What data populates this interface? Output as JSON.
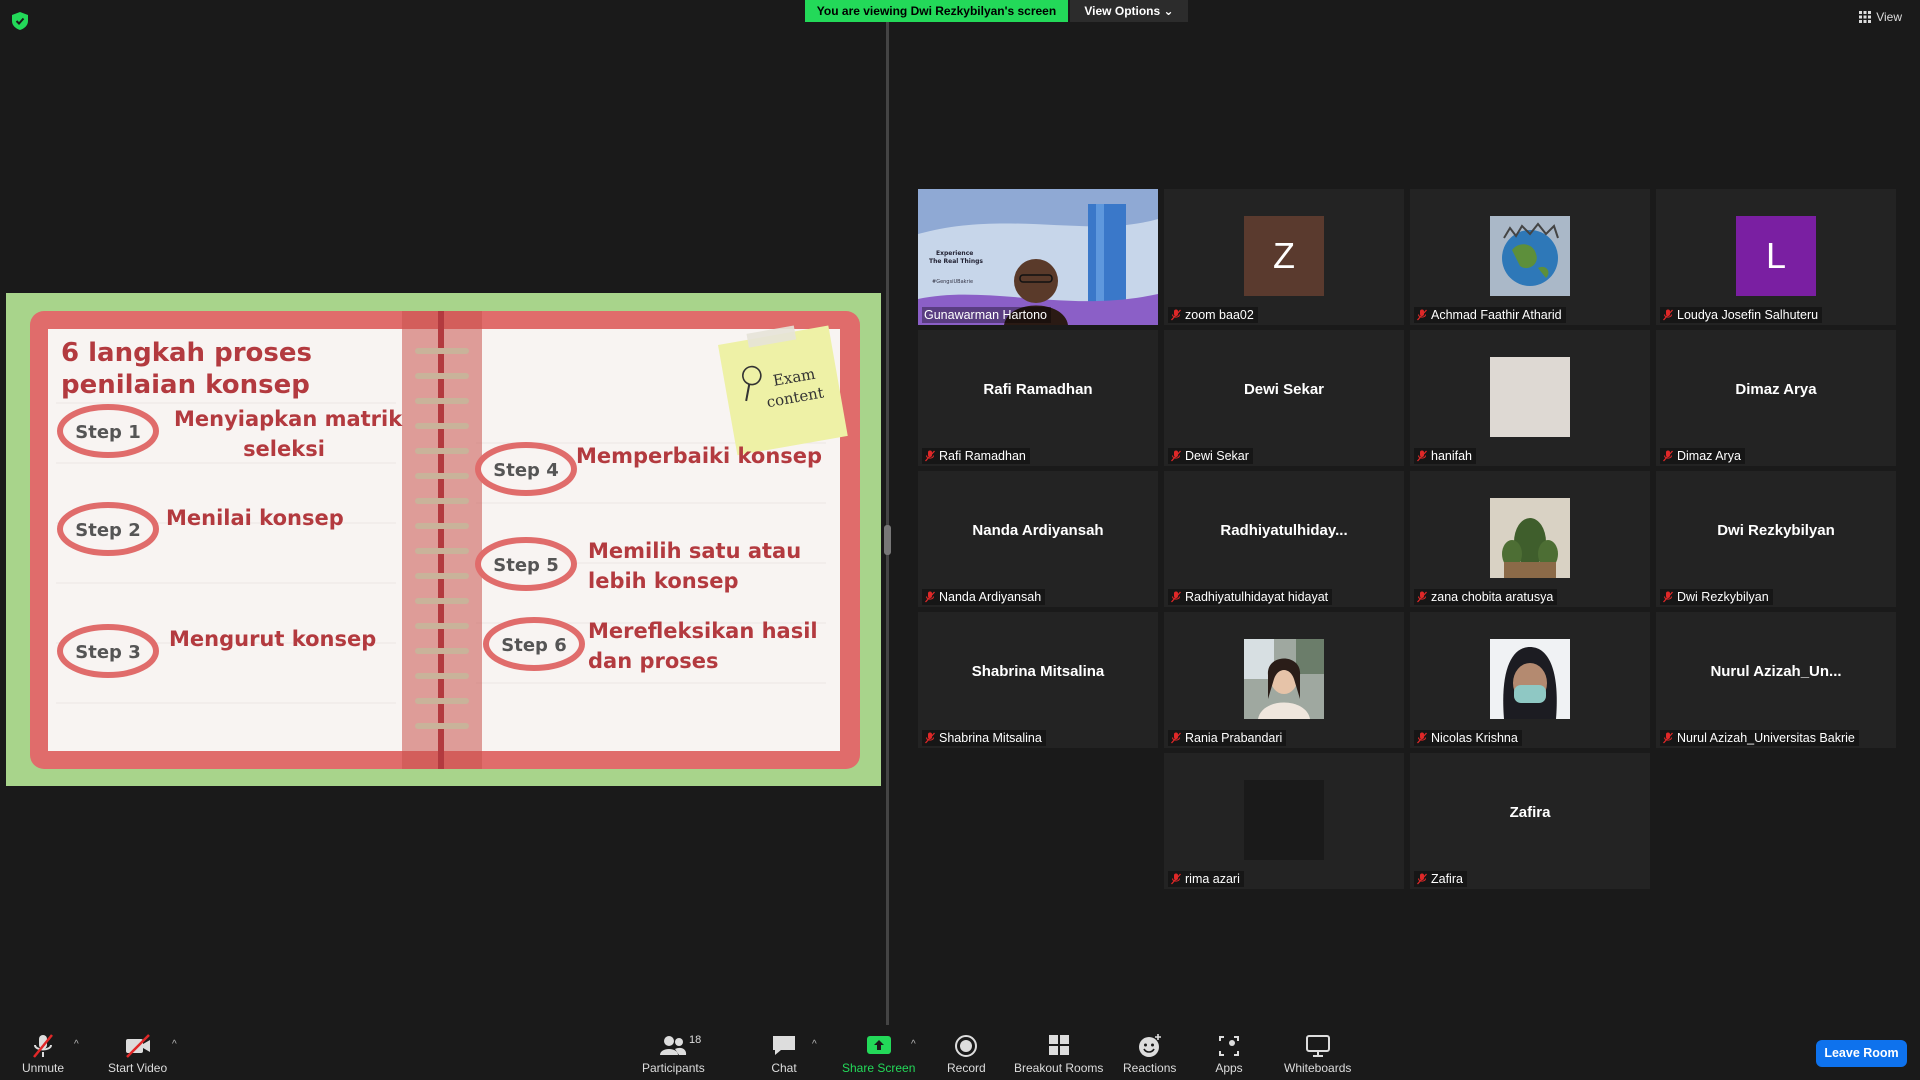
{
  "window": {
    "banner_text": "You are viewing Dwi Rezkybilyan's screen",
    "view_options_label": "View Options",
    "view_label": "View"
  },
  "slide": {
    "title_line1": "6 langkah proses",
    "title_line2": "penilaian konsep",
    "note_line1": "Exam",
    "note_line2": "content",
    "steps": [
      {
        "badge": "Step 1",
        "text_line1": "Menyiapkan matrik",
        "text_line2": "seleksi"
      },
      {
        "badge": "Step 2",
        "text_line1": "Menilai konsep",
        "text_line2": ""
      },
      {
        "badge": "Step 3",
        "text_line1": "Mengurut konsep",
        "text_line2": ""
      },
      {
        "badge": "Step 4",
        "text_line1": "Memperbaiki konsep",
        "text_line2": ""
      },
      {
        "badge": "Step 5",
        "text_line1": "Memilih satu atau",
        "text_line2": "lebih konsep"
      },
      {
        "badge": "Step 6",
        "text_line1": "Merefleksikan hasil",
        "text_line2": "dan proses"
      }
    ],
    "colors": {
      "bg": "#a8d48b",
      "frame": "#e06c6b",
      "paper": "#f8f4f2",
      "text": "#b33a3f",
      "note": "#eef1a6"
    }
  },
  "video_slide": {
    "line1": "Experience",
    "line2": "The Real Things",
    "line3": "#GengsiUBakrie"
  },
  "participants": [
    {
      "name": "Gunawarman Hartono",
      "display": "",
      "kind": "video",
      "muted": false,
      "active": true
    },
    {
      "name": "zoom baa02",
      "display": "Z",
      "kind": "letter",
      "color": "#5a3a2e",
      "muted": true
    },
    {
      "name": "Achmad Faathir Atharid",
      "display": "",
      "kind": "globe",
      "muted": true
    },
    {
      "name": "Loudya Josefin Salhuteru",
      "display": "L",
      "kind": "letter",
      "color": "#7a1fa2",
      "muted": true
    },
    {
      "name": "Rafi Ramadhan",
      "display": "Rafi Ramadhan",
      "kind": "text",
      "muted": true
    },
    {
      "name": "Dewi Sekar",
      "display": "Dewi Sekar",
      "kind": "text",
      "muted": true
    },
    {
      "name": "hanifah",
      "display": "",
      "kind": "plain",
      "color": "#ded9d3",
      "muted": true
    },
    {
      "name": "Dimaz Arya",
      "display": "Dimaz Arya",
      "kind": "text",
      "muted": true
    },
    {
      "name": "Nanda Ardiyansah",
      "display": "Nanda Ardiyansah",
      "kind": "text",
      "muted": true
    },
    {
      "name": "Radhiyatulhidayat hidayat",
      "display": "Radhiyatulhiday...",
      "kind": "text",
      "muted": true
    },
    {
      "name": "zana chobita aratusya",
      "display": "",
      "kind": "cactus",
      "muted": true
    },
    {
      "name": "Dwi Rezkybilyan",
      "display": "Dwi Rezkybilyan",
      "kind": "text",
      "muted": true
    },
    {
      "name": "Shabrina Mitsalina",
      "display": "Shabrina Mitsalina",
      "kind": "text",
      "muted": true
    },
    {
      "name": "Rania Prabandari",
      "display": "",
      "kind": "photo",
      "muted": true
    },
    {
      "name": "Nicolas Krishna",
      "display": "",
      "kind": "mask",
      "muted": true
    },
    {
      "name": "Nurul Azizah_Universitas Bakrie",
      "display": "Nurul  Azizah_Un...",
      "kind": "text",
      "muted": true
    },
    {
      "name": "rima azari",
      "display": "",
      "kind": "plain",
      "color": "#1a1a1a",
      "muted": true
    },
    {
      "name": "Zafira",
      "display": "Zafira",
      "kind": "text",
      "muted": true
    }
  ],
  "toolbar": {
    "unmute": "Unmute",
    "start_video": "Start Video",
    "participants": "Participants",
    "participants_count": "18",
    "chat": "Chat",
    "share_screen": "Share Screen",
    "record": "Record",
    "breakout_rooms": "Breakout Rooms",
    "reactions": "Reactions",
    "apps": "Apps",
    "whiteboards": "Whiteboards",
    "leave_room": "Leave Room"
  }
}
